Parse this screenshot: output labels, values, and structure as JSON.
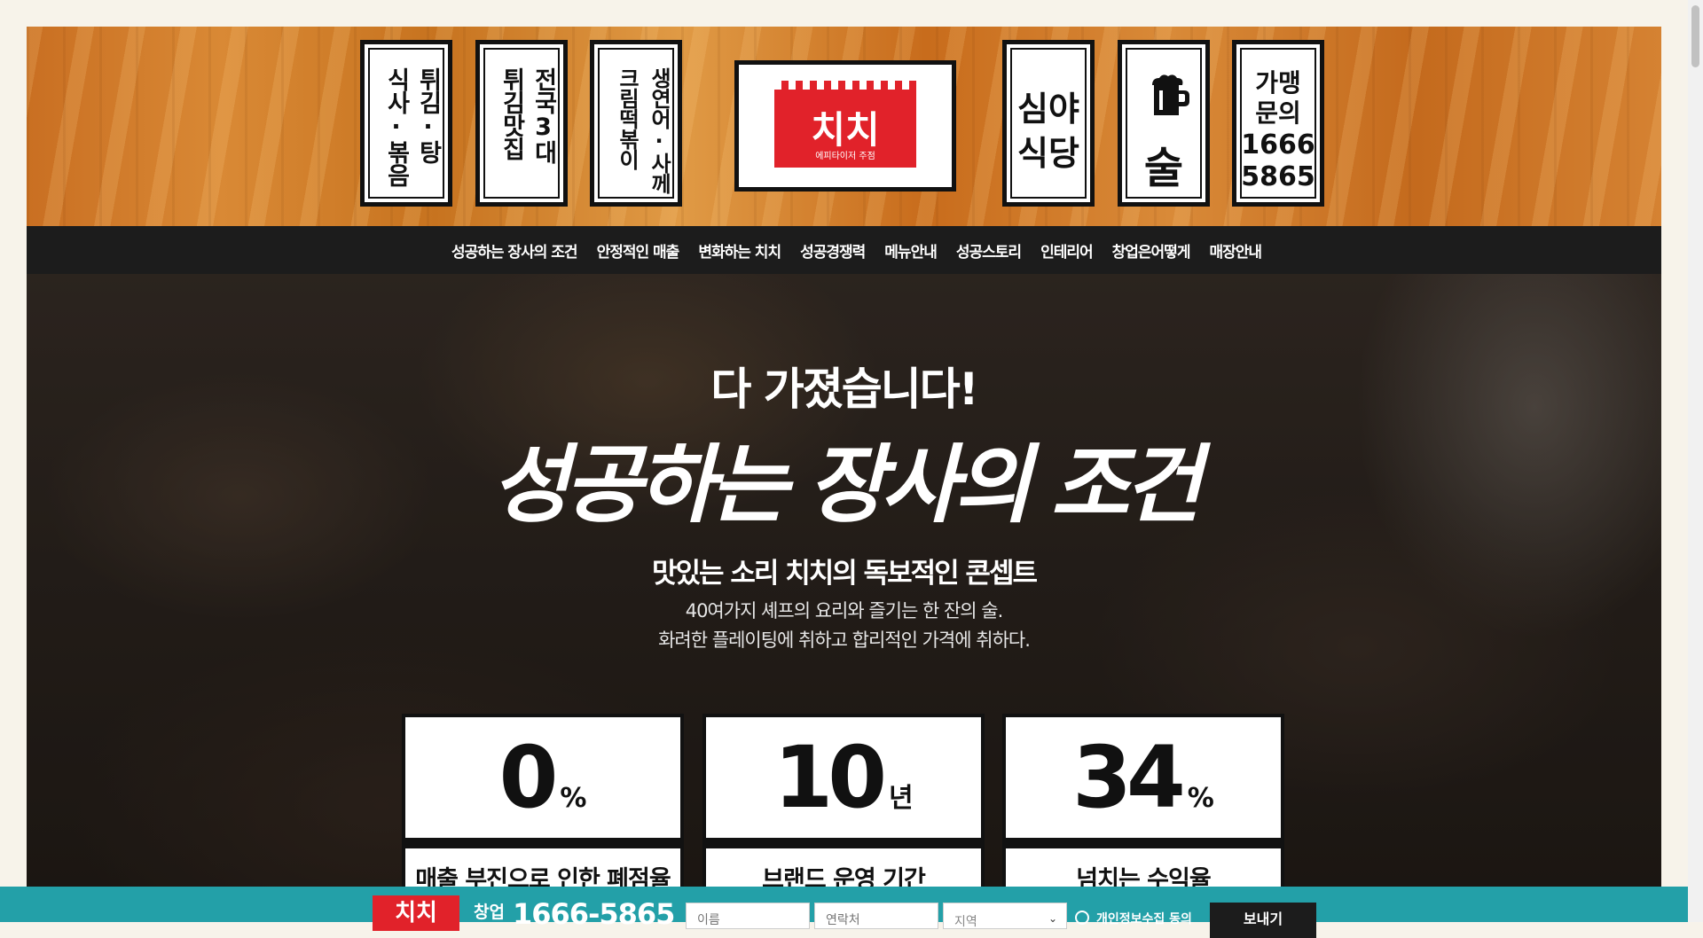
{
  "header": {
    "sign1": [
      "튀김·탕",
      "식사·볶음"
    ],
    "sign2": [
      "전국3대",
      "튀김맛집"
    ],
    "sign3": [
      "생연어·사께",
      "크림떡볶이"
    ],
    "logo_main": "치치",
    "logo_sub": "에피타이저 주점",
    "sign4": [
      "심야",
      "식당"
    ],
    "sign5_icon": "beer-mug-icon",
    "sign5": "술",
    "sign6": [
      "가맹",
      "문의",
      "1666",
      "5865"
    ]
  },
  "nav": {
    "items": [
      "성공하는 장사의 조건",
      "안정적인 매출",
      "변화하는 치치",
      "성공경쟁력",
      "메뉴안내",
      "성공스토리",
      "인테리어",
      "창업은어떻게",
      "매장안내"
    ]
  },
  "hero": {
    "pre": "다 가졌습니다!",
    "title": "성공하는 장사의 조건",
    "subtitle": "맛있는 소리 치치의 독보적인 콘셉트",
    "desc1": "40여가지 셰프의 요리와 즐기는 한 잔의 술.",
    "desc2": "화려한 플레이팅에 취하고 합리적인 가격에 취하다."
  },
  "stats": [
    {
      "value": "0",
      "unit": "%",
      "label": "매출 부진으로 인한 폐점율"
    },
    {
      "value": "10",
      "unit": "년",
      "label": "브랜드 운영 기간"
    },
    {
      "value": "34",
      "unit": "%",
      "label": "넘치는 수익율"
    }
  ],
  "bottombar": {
    "logo": "치치",
    "label": "창업",
    "phone": "1666-5865",
    "name_placeholder": "이름",
    "contact_placeholder": "연락처",
    "region_placeholder": "지역",
    "agree": "개인정보수집 동의",
    "send": "보내기"
  },
  "colors": {
    "nav_bg": "#1c1c1c",
    "bottombar_bg": "#23a0a8",
    "brand_red": "#e1222a"
  }
}
